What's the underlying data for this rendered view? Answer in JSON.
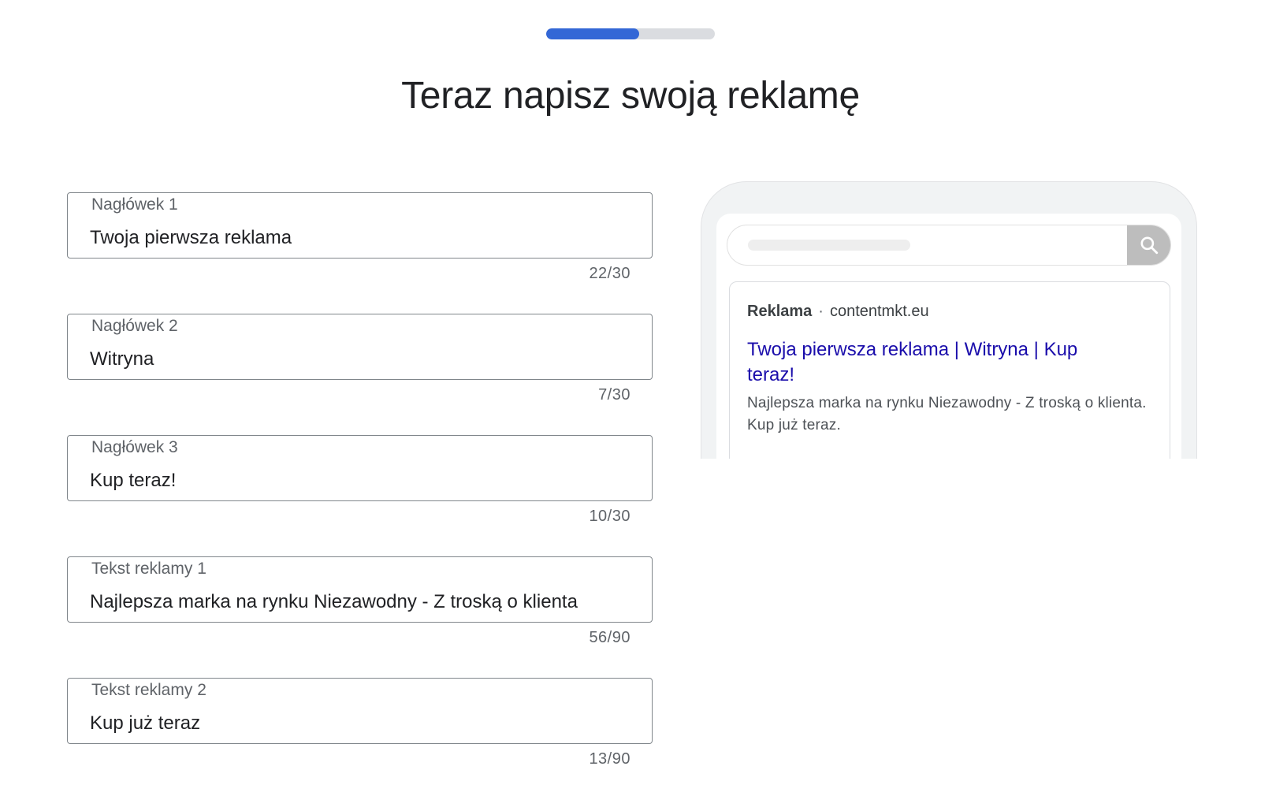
{
  "progress": {
    "value_percent": 55
  },
  "title": "Teraz napisz swoją reklamę",
  "fields": [
    {
      "label": "Nagłówek 1",
      "value": "Twoja pierwsza reklama",
      "counter": "22/30"
    },
    {
      "label": "Nagłówek 2",
      "value": "Witryna",
      "counter": "7/30"
    },
    {
      "label": "Nagłówek 3",
      "value": "Kup teraz!",
      "counter": "10/30"
    },
    {
      "label": "Tekst reklamy 1",
      "value": "Najlepsza marka na rynku Niezawodny - Z troską o klienta",
      "counter": "56/90"
    },
    {
      "label": "Tekst reklamy 2",
      "value": "Kup już teraz",
      "counter": "13/90"
    }
  ],
  "preview": {
    "search_icon": "search-icon",
    "ad_badge": "Reklama",
    "separator": "·",
    "url": "contentmkt.eu",
    "headline": "Twoja pierwsza reklama | Witryna | Kup teraz!",
    "description": "Najlepsza marka na rynku Niezawodny - Z troską o klienta. Kup już teraz."
  },
  "colors": {
    "accent": "#3367d6",
    "track": "#dadce0",
    "ad_link": "#1a0dab"
  }
}
